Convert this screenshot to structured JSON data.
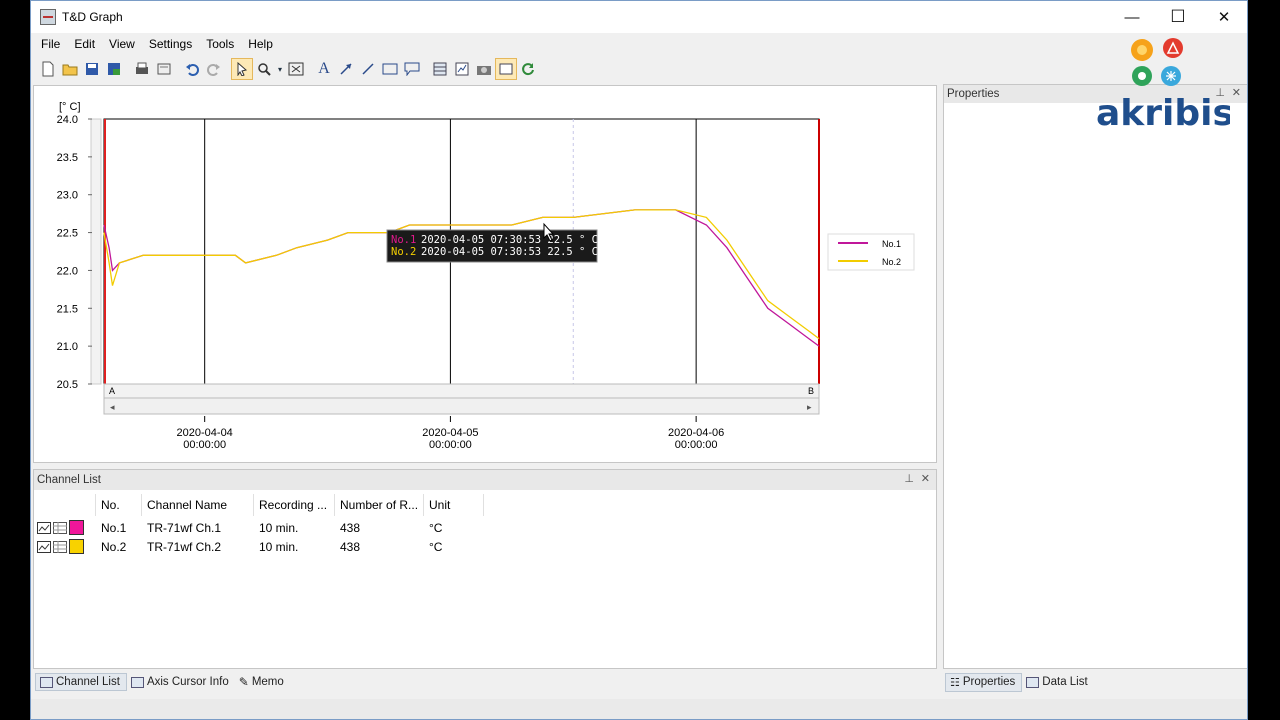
{
  "window": {
    "title": "T&D Graph",
    "minimize": "—",
    "maximize": "☐",
    "close": "✕"
  },
  "menu": [
    "File",
    "Edit",
    "View",
    "Settings",
    "Tools",
    "Help"
  ],
  "graph": {
    "y_unit": "[° C]",
    "y_ticks": [
      "24.0",
      "23.5",
      "23.0",
      "22.5",
      "22.0",
      "21.5",
      "21.0",
      "20.5"
    ],
    "x_ticks": [
      {
        "date": "2020-04-04",
        "time": "00:00:00"
      },
      {
        "date": "2020-04-05",
        "time": "00:00:00"
      },
      {
        "date": "2020-04-06",
        "time": "00:00:00"
      }
    ],
    "cursor_a": "A",
    "cursor_b": "B",
    "scroll_left": "◂",
    "scroll_right": "▸",
    "tooltip": [
      {
        "label": "No.1",
        "value": "2020-04-05 07:30:53 22.5 ° C",
        "color": "#e0198c"
      },
      {
        "label": "No.2",
        "value": "2020-04-05 07:30:53 22.5 ° C",
        "color": "#f5d000"
      }
    ],
    "legend": [
      {
        "name": "No.1",
        "color": "#c0179a"
      },
      {
        "name": "No.2",
        "color": "#f2cc00"
      }
    ]
  },
  "chart_data": {
    "type": "line",
    "ylim": [
      20.5,
      24.0
    ],
    "x_range": [
      "2020-04-03 14:10",
      "2020-04-06 12:00"
    ],
    "series": [
      {
        "name": "No.1",
        "color": "#c0179a",
        "points": [
          [
            "2020-04-03 14:10",
            22.6
          ],
          [
            "2020-04-03 14:40",
            22.3
          ],
          [
            "2020-04-03 15:00",
            22.0
          ],
          [
            "2020-04-03 15:40",
            22.1
          ],
          [
            "2020-04-03 18:00",
            22.2
          ],
          [
            "2020-04-03 23:00",
            22.2
          ],
          [
            "2020-04-04 03:00",
            22.2
          ],
          [
            "2020-04-04 04:00",
            22.1
          ],
          [
            "2020-04-04 07:00",
            22.2
          ],
          [
            "2020-04-04 09:00",
            22.3
          ],
          [
            "2020-04-04 12:00",
            22.4
          ],
          [
            "2020-04-04 14:00",
            22.5
          ],
          [
            "2020-04-04 18:00",
            22.5
          ],
          [
            "2020-04-04 20:00",
            22.6
          ],
          [
            "2020-04-05 00:00",
            22.6
          ],
          [
            "2020-04-05 03:00",
            22.6
          ],
          [
            "2020-04-05 06:00",
            22.6
          ],
          [
            "2020-04-05 09:00",
            22.7
          ],
          [
            "2020-04-05 12:00",
            22.7
          ],
          [
            "2020-04-05 18:00",
            22.8
          ],
          [
            "2020-04-05 22:00",
            22.8
          ],
          [
            "2020-04-06 01:00",
            22.6
          ],
          [
            "2020-04-06 03:00",
            22.3
          ],
          [
            "2020-04-06 05:00",
            21.9
          ],
          [
            "2020-04-06 07:00",
            21.5
          ],
          [
            "2020-04-06 09:00",
            21.3
          ],
          [
            "2020-04-06 11:00",
            21.1
          ],
          [
            "2020-04-06 12:00",
            21.0
          ]
        ]
      },
      {
        "name": "No.2",
        "color": "#f2cc00",
        "points": [
          [
            "2020-04-03 14:10",
            22.5
          ],
          [
            "2020-04-03 14:40",
            22.1
          ],
          [
            "2020-04-03 15:00",
            21.8
          ],
          [
            "2020-04-03 15:40",
            22.1
          ],
          [
            "2020-04-03 18:00",
            22.2
          ],
          [
            "2020-04-03 23:00",
            22.2
          ],
          [
            "2020-04-04 03:00",
            22.2
          ],
          [
            "2020-04-04 04:00",
            22.1
          ],
          [
            "2020-04-04 07:00",
            22.2
          ],
          [
            "2020-04-04 09:00",
            22.3
          ],
          [
            "2020-04-04 12:00",
            22.4
          ],
          [
            "2020-04-04 14:00",
            22.5
          ],
          [
            "2020-04-04 18:00",
            22.5
          ],
          [
            "2020-04-04 20:00",
            22.6
          ],
          [
            "2020-04-05 00:00",
            22.6
          ],
          [
            "2020-04-05 03:00",
            22.6
          ],
          [
            "2020-04-05 06:00",
            22.6
          ],
          [
            "2020-04-05 09:00",
            22.7
          ],
          [
            "2020-04-05 12:00",
            22.7
          ],
          [
            "2020-04-05 18:00",
            22.8
          ],
          [
            "2020-04-05 22:00",
            22.8
          ],
          [
            "2020-04-06 01:00",
            22.7
          ],
          [
            "2020-04-06 03:00",
            22.4
          ],
          [
            "2020-04-06 05:00",
            22.0
          ],
          [
            "2020-04-06 07:00",
            21.6
          ],
          [
            "2020-04-06 09:00",
            21.4
          ],
          [
            "2020-04-06 11:00",
            21.2
          ],
          [
            "2020-04-06 12:00",
            21.1
          ]
        ]
      }
    ]
  },
  "channel_list": {
    "title": "Channel List",
    "columns": [
      "No.",
      "Channel Name",
      "Recording ...",
      "Number of R...",
      "Unit"
    ],
    "rows": [
      {
        "no": "No.1",
        "name": "TR-71wf Ch.1",
        "interval": "10 min.",
        "count": "438",
        "unit": "°C",
        "color": "#f0169a"
      },
      {
        "no": "No.2",
        "name": "TR-71wf Ch.2",
        "interval": "10 min.",
        "count": "438",
        "unit": "°C",
        "color": "#f8d200"
      }
    ]
  },
  "properties": {
    "title": "Properties"
  },
  "bottom_tabs_left": [
    "Channel List",
    "Axis Cursor Info",
    "Memo"
  ],
  "bottom_tabs_right": [
    "Properties",
    "Data List"
  ],
  "logo": {
    "text": "akribis"
  }
}
